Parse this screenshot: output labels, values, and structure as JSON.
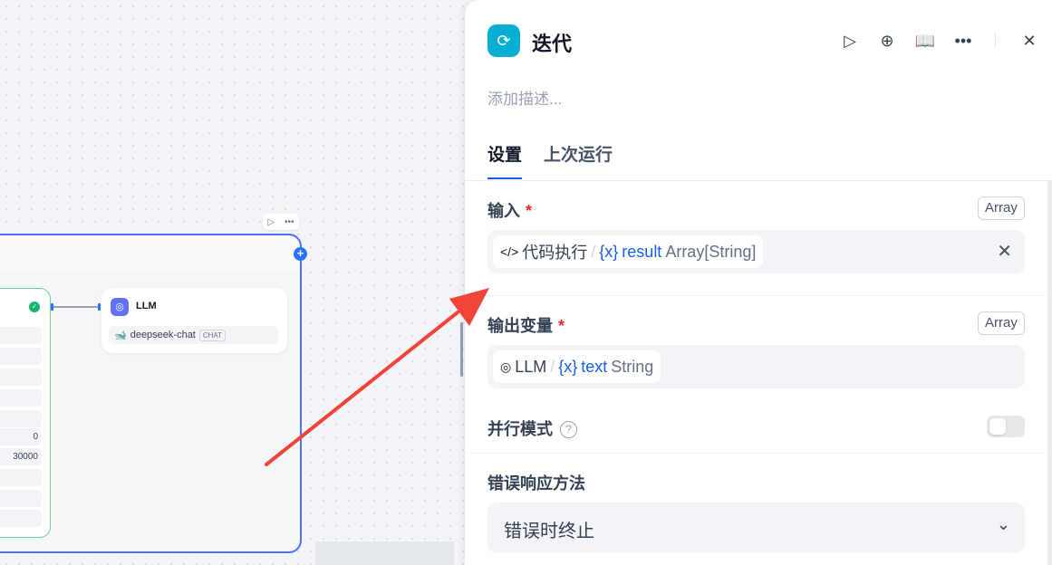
{
  "canvas": {
    "llm_node": {
      "title": "LLM",
      "model": "deepseek-chat",
      "model_badge": "CHAT"
    },
    "code_node": {
      "values": [
        "0",
        "30000"
      ]
    }
  },
  "panel": {
    "title": "迭代",
    "description_placeholder": "添加描述...",
    "tabs": [
      {
        "label": "设置",
        "active": true
      },
      {
        "label": "上次运行",
        "active": false
      }
    ],
    "input": {
      "label": "输入",
      "required_mark": "*",
      "type": "Array",
      "variable": {
        "node": "代码执行",
        "name": "result",
        "type": "Array[String]"
      }
    },
    "output": {
      "label": "输出变量",
      "required_mark": "*",
      "type": "Array",
      "variable": {
        "node": "LLM",
        "name": "text",
        "type": "String"
      }
    },
    "parallel_mode": {
      "label": "并行模式",
      "enabled": false
    },
    "error_handling": {
      "label": "错误响应方法",
      "value": "错误时终止"
    }
  },
  "colors": {
    "accent": "#155eef",
    "node_border": "#4f6ef7",
    "arrow": "#f04438"
  }
}
